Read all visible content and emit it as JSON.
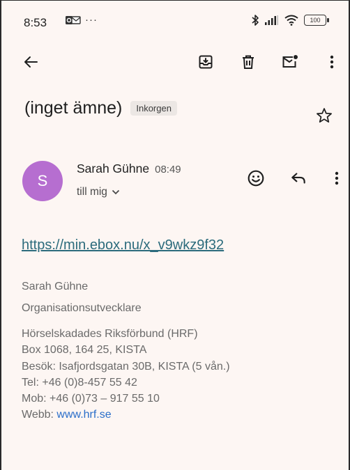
{
  "status_bar": {
    "time": "8:53",
    "extra": "···",
    "battery": "100"
  },
  "toolbar": {
    "back": "back-arrow-icon",
    "archive": "archive-icon",
    "delete": "trash-icon",
    "mark_unread": "mail-unread-icon",
    "more": "more-vert-icon"
  },
  "email": {
    "subject": "(inget ämne)",
    "label": "Inkorgen",
    "sender": {
      "initial": "S",
      "name": "Sarah Gühne",
      "time": "08:49",
      "recipient": "till mig"
    },
    "body": {
      "link": "https://min.ebox.nu/x_v9wkz9f32",
      "signature": {
        "name": "Sarah Gühne",
        "title": "Organisationsutvecklare",
        "org": "Hörselskadades Riksförbund (HRF)",
        "address": "Box 1068, 164 25, KISTA",
        "visit": "Besök: Isafjordsgatan 30B, KISTA (5 vån.)",
        "tel": "Tel: +46 (0)8-457 55 42",
        "mob": "Mob: +46 (0)73 – 917 55 10",
        "web_label": "Webb: ",
        "web_link": "www.hrf.se"
      }
    }
  },
  "colors": {
    "background": "#fdf6f3",
    "avatar": "#b66ed0",
    "link": "#2b6b7c",
    "web_link": "#2a6ec9"
  }
}
